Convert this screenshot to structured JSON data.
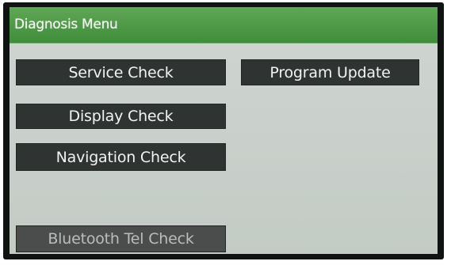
{
  "screen": {
    "title": "Diagnosis Menu"
  },
  "menu": {
    "service_check": "Service Check",
    "display_check": "Display Check",
    "navigation_check": "Navigation Check",
    "bluetooth_check": "Bluetooth Tel Check",
    "program_update": "Program Update"
  },
  "colors": {
    "title_bar": "#4a9a44",
    "button": "#2f3331",
    "button_disabled": "#4a4d4c",
    "background": "#cdd3cf"
  }
}
